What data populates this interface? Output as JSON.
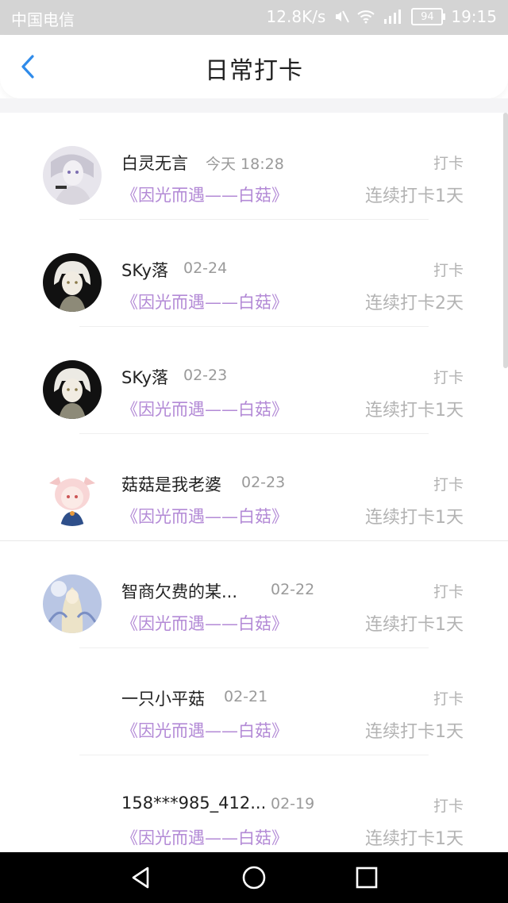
{
  "status_bar": {
    "carrier": "中国电信",
    "speed": "12.8K/s",
    "battery": "94",
    "time": "19:15"
  },
  "header": {
    "title": "日常打卡"
  },
  "entries": [
    {
      "name": "白灵无言",
      "date": "今天 18:28",
      "label": "打卡",
      "book": "《因光而遇——白菇》",
      "streak": "连续打卡1天"
    },
    {
      "name": "SKy落",
      "date": "02-24",
      "label": "打卡",
      "book": "《因光而遇——白菇》",
      "streak": "连续打卡2天"
    },
    {
      "name": "SKy落",
      "date": "02-23",
      "label": "打卡",
      "book": "《因光而遇——白菇》",
      "streak": "连续打卡1天"
    },
    {
      "name": "菇菇是我老婆",
      "date": "02-23",
      "label": "打卡",
      "book": "《因光而遇——白菇》",
      "streak": "连续打卡1天"
    },
    {
      "name": "智商欠费的某...",
      "date": "02-22",
      "label": "打卡",
      "book": "《因光而遇——白菇》",
      "streak": "连续打卡1天"
    },
    {
      "name": "一只小平菇",
      "date": "02-21",
      "label": "打卡",
      "book": "《因光而遇——白菇》",
      "streak": "连续打卡1天"
    },
    {
      "name": "158***985_412...",
      "date": "02-19",
      "label": "打卡",
      "book": "《因光而遇——白菇》",
      "streak": "连续打卡1天"
    }
  ],
  "icons": {
    "back": "chevron-left-icon",
    "nav_back": "triangle-back-icon",
    "nav_home": "circle-home-icon",
    "nav_recent": "square-recent-icon"
  },
  "colors": {
    "accent_blue": "#2f8bea",
    "book_purple": "#b38ad6",
    "muted_gray": "#b3b3b3"
  }
}
